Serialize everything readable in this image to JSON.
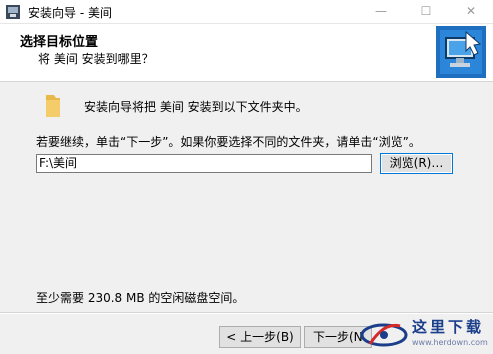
{
  "window": {
    "title": "安装向导 - 美间",
    "minimize_glyph": "—",
    "maximize_glyph": "☐",
    "close_glyph": "✕"
  },
  "header": {
    "title": "选择目标位置",
    "subtitle": "将 美间 安装到哪里？"
  },
  "body": {
    "intro": "安装向导将把 美间 安装到以下文件夹中。",
    "instruction": "若要继续，单击“下一步”。如果你要选择不同的文件夹，请单击“浏览”。",
    "path_value": "F:\\美间",
    "browse_label": "浏览(R)…",
    "space_required": "至少需要 230.8 MB 的空闲磁盘空间。"
  },
  "footer": {
    "back_label": "< 上一步(B)",
    "next_label": "下一步(N"
  },
  "watermark": {
    "text": "这里下载",
    "url": "www.herdown.com"
  },
  "icons": {
    "app": "installer-icon",
    "folder": "folder-icon",
    "wizard": "computer-wizard-icon"
  },
  "colors": {
    "accent": "#0078d7",
    "window_bg": "#f0f0f0"
  }
}
